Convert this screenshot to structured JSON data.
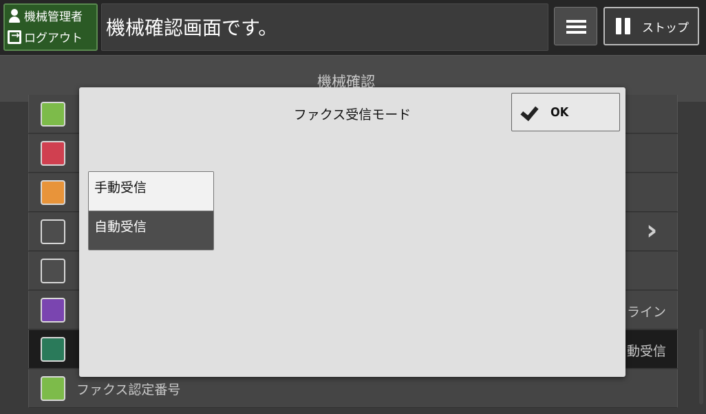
{
  "topbar": {
    "user_name": "機械管理者",
    "logout_label": "ログアウト",
    "message": "機械確認画面です。",
    "stop_label": "ストップ"
  },
  "screen": {
    "title": "機械確認",
    "rows": [
      {
        "label": "",
        "value": "",
        "icon": "counter-icon",
        "color": "#7dbb4a"
      },
      {
        "label": "",
        "value": "",
        "icon": "error-log-icon",
        "color": "#d04050"
      },
      {
        "label": "",
        "value": "",
        "icon": "consumables-icon",
        "color": "#e8943a"
      },
      {
        "label": "",
        "value": "",
        "icon": "tray-icon",
        "color": "#4d4d4d"
      },
      {
        "label": "",
        "value": "",
        "icon": "report-list-icon",
        "color": "#4d4d4d"
      },
      {
        "label": "",
        "value": "ライン",
        "icon": "printer-icon",
        "color": "#7a45b0"
      },
      {
        "label": "",
        "value": "動受信",
        "icon": "fax-icon",
        "color": "#2a7a5a"
      },
      {
        "label": "ファクス認定番号",
        "value": "",
        "icon": "fax-cert-icon",
        "color": "#7dbb4a"
      }
    ]
  },
  "dialog": {
    "title": "ファクス受信モード",
    "ok_label": "OK",
    "options": [
      {
        "label": "手動受信",
        "selected": false
      },
      {
        "label": "自動受信",
        "selected": true
      }
    ]
  }
}
